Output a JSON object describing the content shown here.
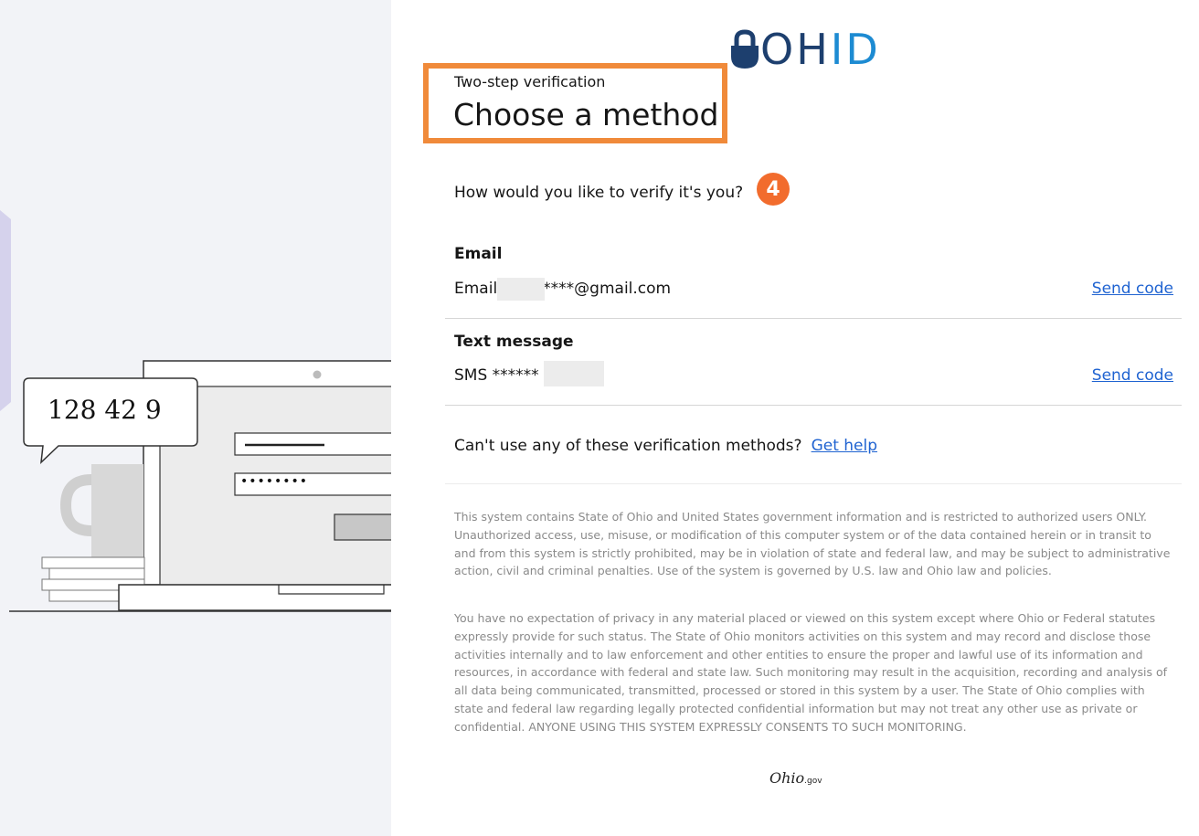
{
  "branding": {
    "logo_oh": "OH",
    "logo_id": "ID",
    "footer_logo": "Ohio",
    "footer_logo_suffix": ".gov"
  },
  "illustration": {
    "code_bubble": "128 42 9",
    "password_dots": "••••••••"
  },
  "header": {
    "eyebrow": "Two-step verification",
    "title": "Choose a method"
  },
  "prompt": {
    "question": "How would you like to verify it's you?",
    "step_badge": "4"
  },
  "methods": [
    {
      "label": "Email",
      "value_prefix": "Email",
      "value_suffix": "****@gmail.com",
      "action": "Send code"
    },
    {
      "label": "Text message",
      "value_prefix": "SMS",
      "value_suffix": "******",
      "action": "Send code"
    }
  ],
  "help": {
    "text": "Can't use any of these verification methods?",
    "link": "Get help"
  },
  "legal": {
    "paragraph_1": "This system contains State of Ohio and United States government information and is restricted to authorized users ONLY. Unauthorized access, use, misuse, or modification of this computer system or of the data contained herein or in transit to and from this system is strictly prohibited, may be in violation of state and federal law, and may be subject to administrative action, civil and criminal penalties. Use of the system is governed by U.S. law and Ohio law and policies.",
    "paragraph_2": "You have no expectation of privacy in any material placed or viewed on this system except where Ohio or Federal statutes expressly provide for such status. The State of Ohio monitors activities on this system and may record and disclose those activities internally and to law enforcement and other entities to ensure the proper and lawful use of its information and resources, in accordance with federal and state law. Such monitoring may result in the acquisition, recording and analysis of all data being communicated, transmitted, processed or stored in this system by a user. The State of Ohio complies with state and federal law regarding legally protected confidential information but may not treat any other use as private or confidential. ANYONE USING THIS SYSTEM EXPRESSLY CONSENTS TO SUCH MONITORING."
  },
  "colors": {
    "highlight_border": "#f08a3a",
    "badge": "#f26c2d",
    "link": "#1f63d1",
    "logo_dark": "#1d3f6e",
    "logo_light": "#1d8bd2"
  }
}
